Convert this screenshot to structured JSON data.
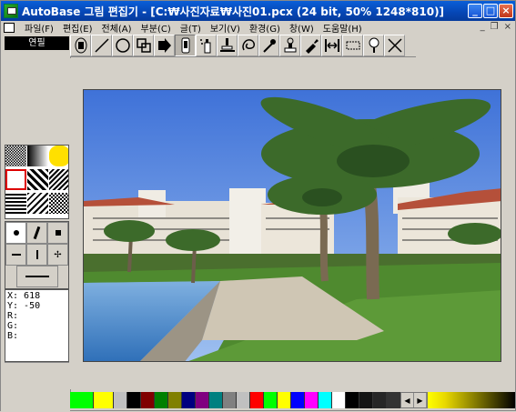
{
  "window": {
    "title": "AutoBase 그림 편집기 - [C:₩사진자료₩사진01.pcx (24 bit, 50% 1248*810)]"
  },
  "menu": {
    "items": [
      "파일(F)",
      "편집(E)",
      "전체(A)",
      "부분(C)",
      "글(T)",
      "보기(V)",
      "환경(G)",
      "창(W)",
      "도움말(H)"
    ]
  },
  "left": {
    "mode": "연필",
    "coords": {
      "x": "X: 618",
      "y": "Y: -50",
      "r": "R:",
      "g": "G:",
      "b": "B:"
    }
  },
  "toolbar": {
    "tools": [
      "select-icon",
      "line-icon",
      "circle-icon",
      "copy-area-icon",
      "fill-icon",
      "pencil-icon",
      "spray-icon",
      "brush-icon",
      "lasso-icon",
      "eyedropper-icon",
      "stamp-icon",
      "smudge-icon",
      "resize-icon",
      "rectangle-icon",
      "zoom-icon",
      "clear-icon"
    ]
  },
  "palette": {
    "colors": [
      "#00ff00",
      "#d4d0c8",
      "#ffff00",
      "#c0c0c0",
      "#000000",
      "#800000",
      "#008000",
      "#808000",
      "#000080",
      "#800080",
      "#008080",
      "#808080",
      "#c0c0c0",
      "#ff0000",
      "#00ff00",
      "#ffff00",
      "#0000ff",
      "#ff00ff",
      "#00ffff",
      "#ffffff",
      "#000000",
      "#101010",
      "#202020",
      "#303030"
    ]
  }
}
